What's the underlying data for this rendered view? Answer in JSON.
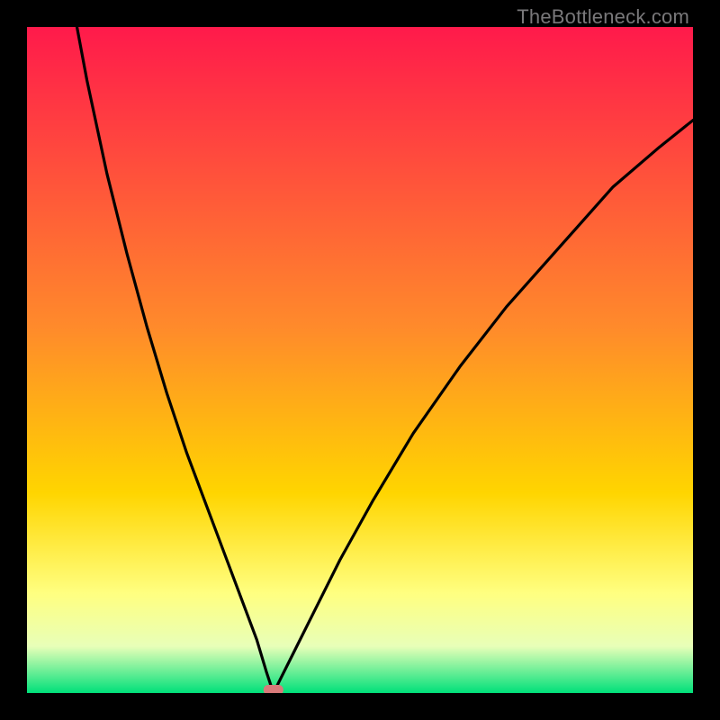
{
  "watermark": {
    "text": "TheBottleneck.com"
  },
  "colors": {
    "top": "#ff1a4b",
    "mid1": "#ff7a2b",
    "mid2": "#ffd500",
    "mid3": "#ffff66",
    "mid4": "#e8ffb8",
    "bottom": "#00e07a",
    "curve": "#000000",
    "marker": "#d97a7a",
    "frame": "#000000"
  },
  "chart_data": {
    "type": "line",
    "title": "",
    "xlabel": "",
    "ylabel": "",
    "xlim": [
      0,
      100
    ],
    "ylim": [
      0,
      100
    ],
    "x_min_at": 37,
    "marker": {
      "x": 37,
      "y": 0
    },
    "series": [
      {
        "name": "bottleneck-curve",
        "x": [
          0,
          3,
          6,
          9,
          12,
          15,
          18,
          21,
          24,
          27,
          30,
          33,
          34.5,
          36,
          37,
          38,
          40,
          43,
          47,
          52,
          58,
          65,
          72,
          80,
          88,
          95,
          100
        ],
        "values": [
          160,
          126,
          108,
          92,
          78,
          66,
          55,
          45,
          36,
          28,
          20,
          12,
          8,
          3,
          0,
          2,
          6,
          12,
          20,
          29,
          39,
          49,
          58,
          67,
          76,
          82,
          86
        ]
      }
    ],
    "gradient_stops": [
      {
        "pct": 0,
        "color": "#ff1a4b"
      },
      {
        "pct": 45,
        "color": "#ff8a2b"
      },
      {
        "pct": 70,
        "color": "#ffd500"
      },
      {
        "pct": 85,
        "color": "#ffff80"
      },
      {
        "pct": 93,
        "color": "#e8ffb8"
      },
      {
        "pct": 100,
        "color": "#00e07a"
      }
    ]
  }
}
